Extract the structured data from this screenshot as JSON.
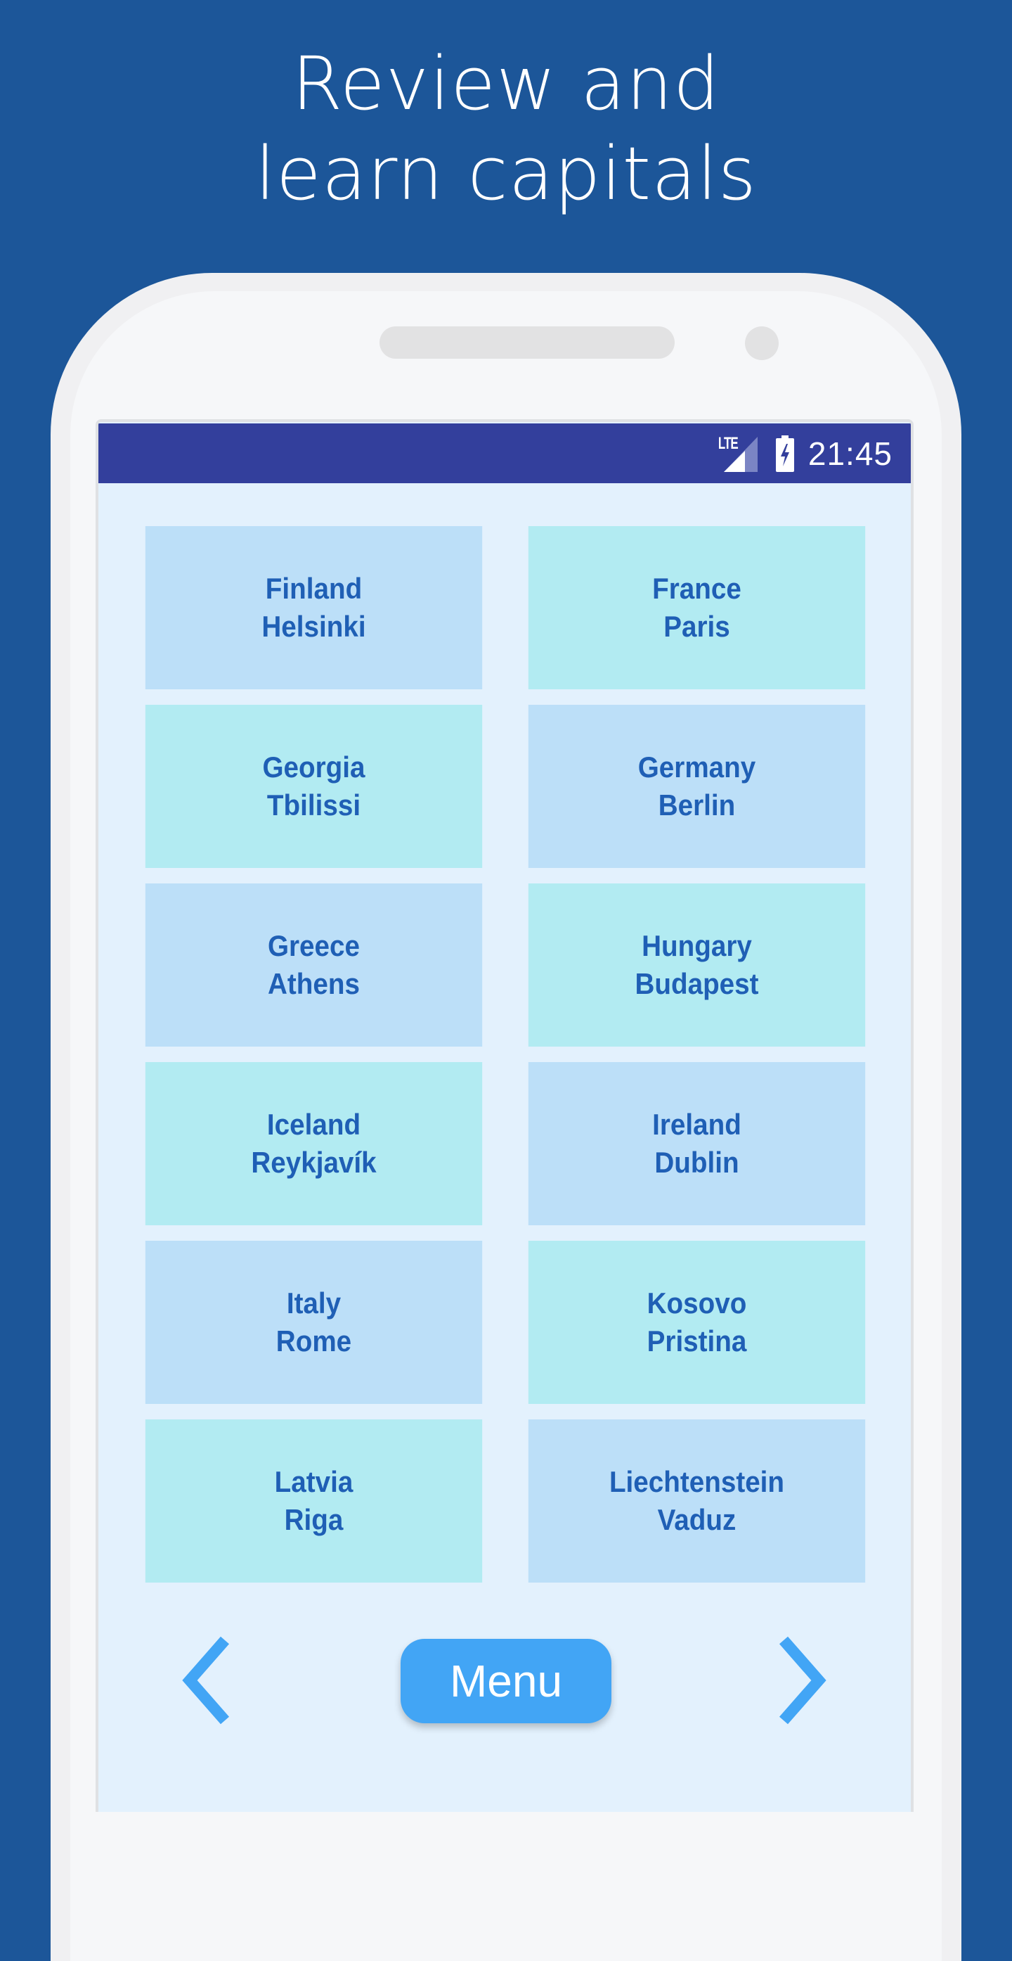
{
  "headline": {
    "line1": "Review and",
    "line2": "learn capitals"
  },
  "status_bar": {
    "network": "LTE",
    "time": "21:45",
    "icons": [
      "lte-signal-icon",
      "battery-charging-icon"
    ]
  },
  "cards": [
    {
      "country": "Finland",
      "capital": "Helsinki",
      "color": "#bcdff8"
    },
    {
      "country": "France",
      "capital": "Paris",
      "color": "#b2ebf2"
    },
    {
      "country": "Georgia",
      "capital": "Tbilissi",
      "color": "#b2ebf2"
    },
    {
      "country": "Germany",
      "capital": "Berlin",
      "color": "#bcdff8"
    },
    {
      "country": "Greece",
      "capital": "Athens",
      "color": "#bcdff8"
    },
    {
      "country": "Hungary",
      "capital": "Budapest",
      "color": "#b2ebf2"
    },
    {
      "country": "Iceland",
      "capital": "Reykjavík",
      "color": "#b2ebf2"
    },
    {
      "country": "Ireland",
      "capital": "Dublin",
      "color": "#bcdff8"
    },
    {
      "country": "Italy",
      "capital": "Rome",
      "color": "#bcdff8"
    },
    {
      "country": "Kosovo",
      "capital": "Pristina",
      "color": "#b2ebf2"
    },
    {
      "country": "Latvia",
      "capital": "Riga",
      "color": "#b2ebf2"
    },
    {
      "country": "Liechtenstein",
      "capital": "Vaduz",
      "color": "#bcdff8"
    }
  ],
  "nav": {
    "menu_label": "Menu",
    "prev_icon": "chevron-left-icon",
    "next_icon": "chevron-right-icon"
  },
  "colors": {
    "background": "#1c5699",
    "status_bar": "#333f9c",
    "screen_bg": "#e3f1fd",
    "card_text": "#1f5fb5",
    "accent": "#42a5f5"
  }
}
